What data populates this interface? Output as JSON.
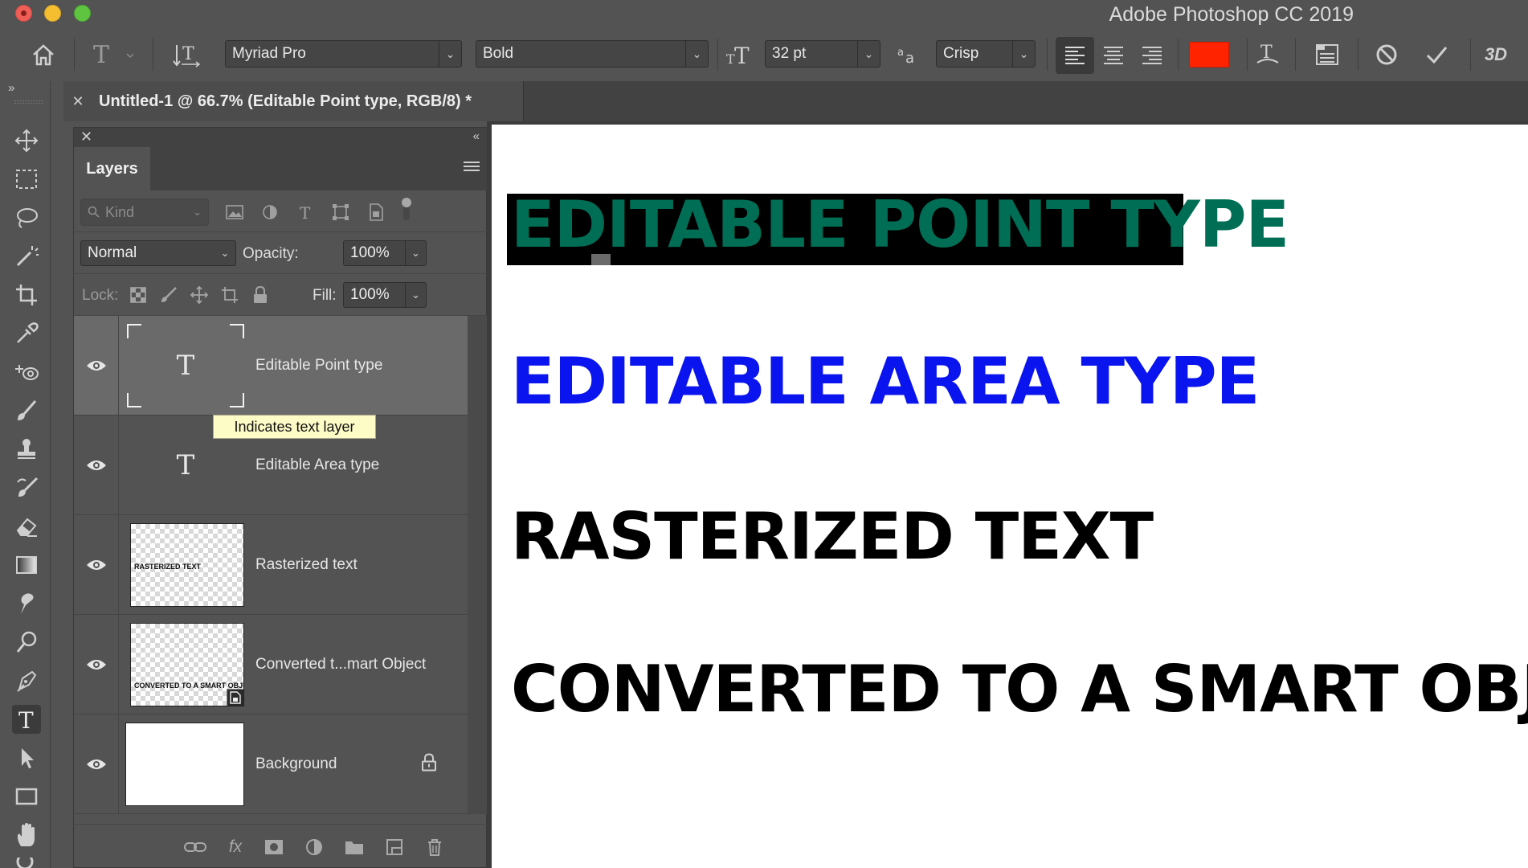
{
  "window": {
    "app_title": "Adobe Photoshop CC 2019"
  },
  "options_bar": {
    "font_family": "Myriad Pro",
    "font_style": "Bold",
    "font_size": "32 pt",
    "antialias": "Crisp",
    "text_color": "#ff2300",
    "three_d_label": "3D"
  },
  "document": {
    "tab_label": "Untitled-1 @ 66.7% (Editable Point type, RGB/8) *"
  },
  "layers_panel": {
    "tab_label": "Layers",
    "filter_placeholder": "Kind",
    "blend_mode": "Normal",
    "opacity_label": "Opacity:",
    "opacity_value": "100%",
    "lock_label": "Lock:",
    "fill_label": "Fill:",
    "fill_value": "100%",
    "tooltip": "Indicates text layer",
    "layers": [
      {
        "name": "Editable Point type",
        "kind": "text",
        "selected": true
      },
      {
        "name": "Editable Area type",
        "kind": "text",
        "selected": false
      },
      {
        "name": "Rasterized text",
        "kind": "raster",
        "thumb_text": "RASTERIZED TEXT",
        "selected": false
      },
      {
        "name": "Converted t...mart Object",
        "kind": "smart-object",
        "thumb_text": "CONVERTED TO A SMART OBJECT",
        "selected": false
      },
      {
        "name": "Background",
        "kind": "background",
        "locked": true,
        "selected": false
      }
    ]
  },
  "canvas": {
    "lines": [
      {
        "text": "EDITABLE POINT TYPE",
        "color": "#006e55",
        "highlight": "#000000"
      },
      {
        "text": "EDITABLE AREA TYPE",
        "color": "#0a14ee"
      },
      {
        "text": "RASTERIZED TEXT",
        "color": "#000000"
      },
      {
        "text": "CONVERTED TO A SMART OBJECT",
        "color": "#000000"
      }
    ]
  }
}
